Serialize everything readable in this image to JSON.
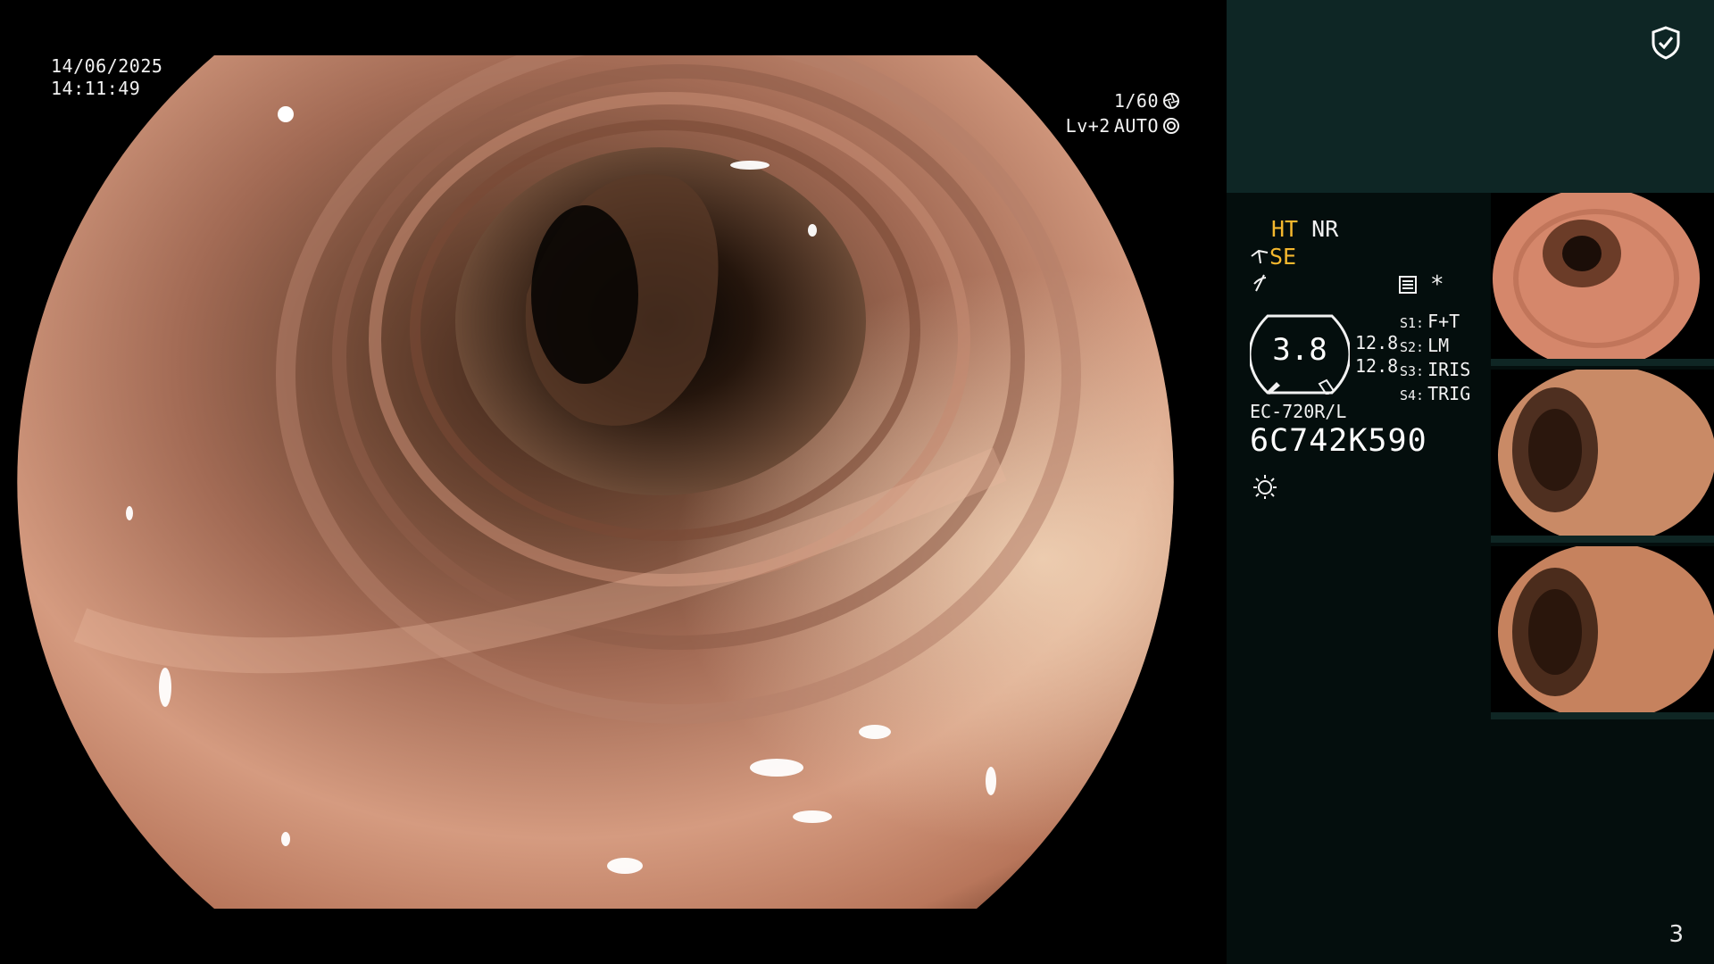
{
  "overlay": {
    "date": "14/06/2025",
    "time": "14:11:49",
    "shutter": "1/60",
    "level": "Lv+2",
    "iris": "AUTO"
  },
  "panel": {
    "modes": {
      "ht": "HT",
      "nr": "NR",
      "se": "SE"
    },
    "ratio_display": "3.8",
    "ratios": [
      "12.8",
      "12.8"
    ],
    "switches": [
      {
        "key": "S1:",
        "value": "F+T"
      },
      {
        "key": "S2:",
        "value": "LM"
      },
      {
        "key": "S3:",
        "value": "IRIS"
      },
      {
        "key": "S4:",
        "value": "TRIG"
      }
    ],
    "scope_model": "EC-720R/L",
    "scope_serial": "6C742K590",
    "thumbnail_count": "3"
  },
  "colors": {
    "accent": "#f5b82e",
    "panel_top": "#0e2625",
    "panel_body": "#040e0d"
  }
}
